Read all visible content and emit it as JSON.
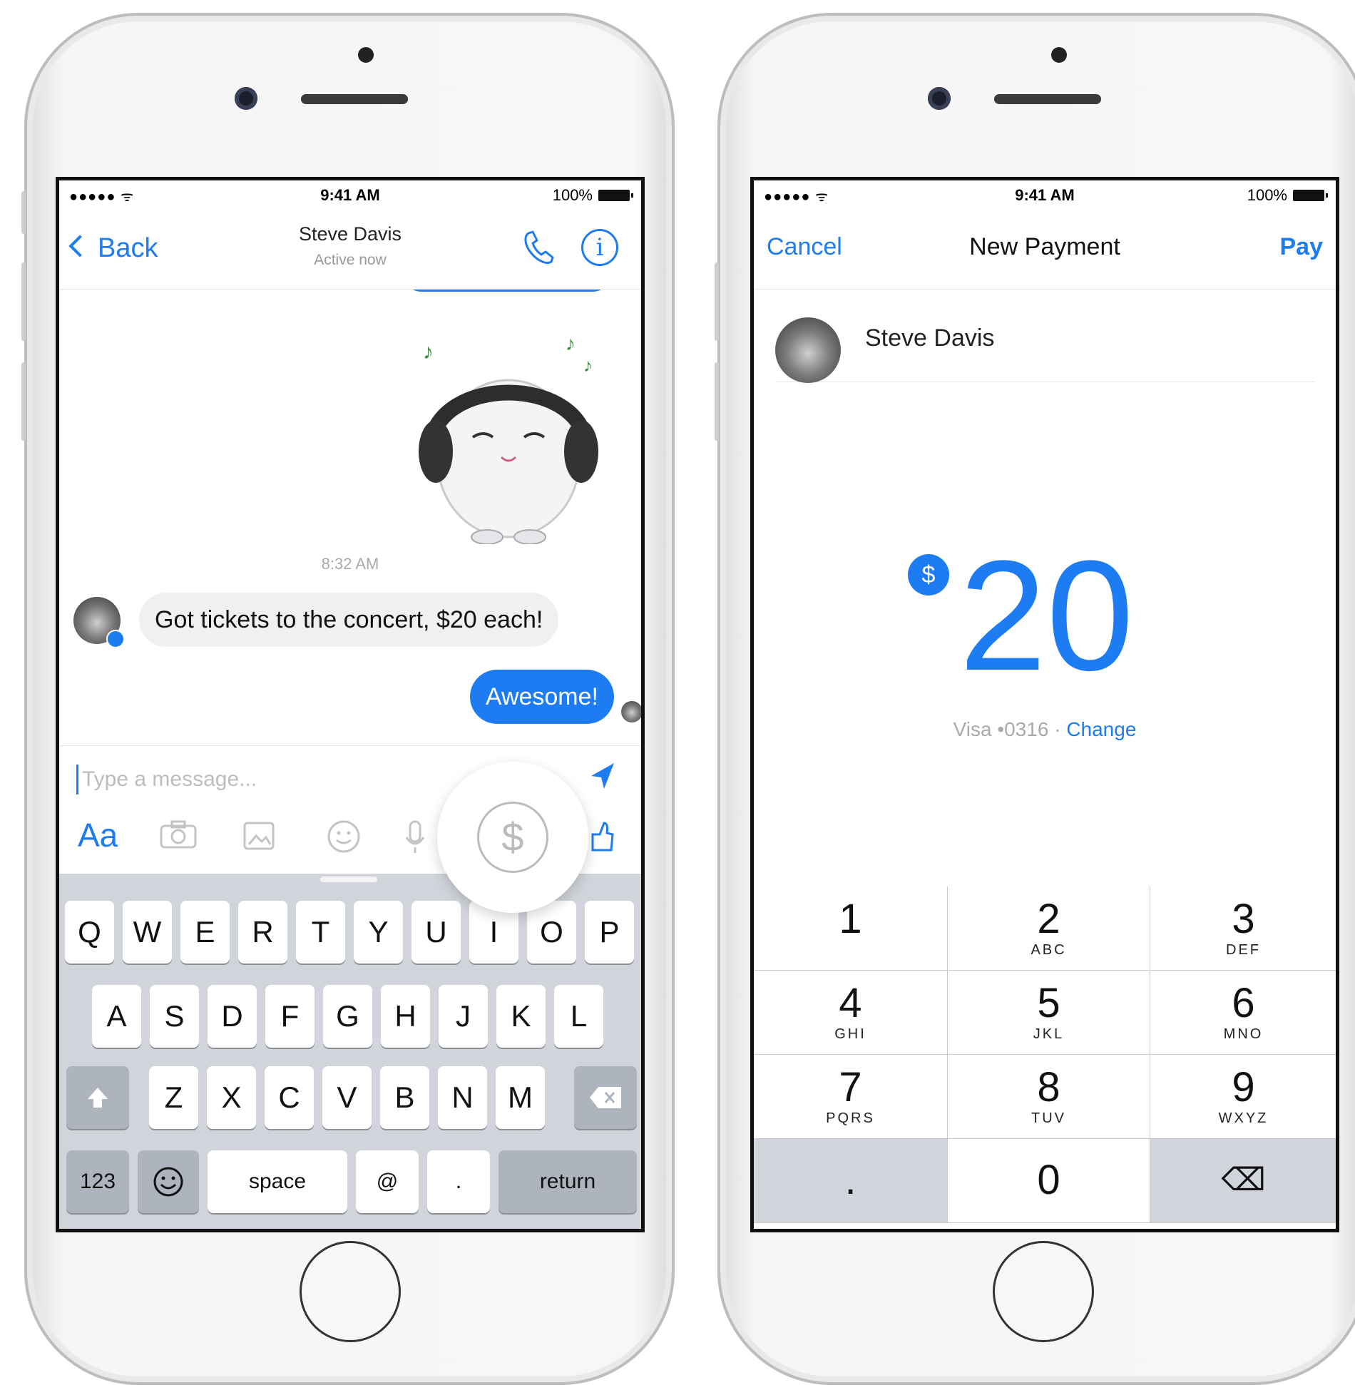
{
  "chat": {
    "status": {
      "signal": "●●●●● ᯤ",
      "time": "9:41 AM",
      "battery": "100%"
    },
    "back_label": "Back",
    "contact_name": "Steve Davis",
    "contact_status": "Active now",
    "timestamp": "8:32 AM",
    "incoming_message": "Got tickets to the concert, $20 each!",
    "outgoing_message": "Awesome!",
    "composer_placeholder": "Type a message...",
    "text_format_label": "Aa",
    "payment_icon_symbol": "$"
  },
  "keyboard": {
    "row1": [
      "Q",
      "W",
      "E",
      "R",
      "T",
      "Y",
      "U",
      "I",
      "O",
      "P"
    ],
    "row2": [
      "A",
      "S",
      "D",
      "F",
      "G",
      "H",
      "J",
      "K",
      "L"
    ],
    "row3": [
      "Z",
      "X",
      "C",
      "V",
      "B",
      "N",
      "M"
    ],
    "numbers_label": "123",
    "space_label": "space",
    "at_label": "@",
    "period_label": ".",
    "return_label": "return"
  },
  "payment": {
    "status": {
      "signal": "●●●●● ᯤ",
      "time": "9:41 AM",
      "battery": "100%"
    },
    "cancel_label": "Cancel",
    "title": "New Payment",
    "pay_label": "Pay",
    "recipient": "Steve Davis",
    "currency_symbol": "$",
    "amount": "20",
    "card_info": "Visa •0316 ·",
    "change_label": "Change",
    "keypad": [
      {
        "num": "1",
        "letters": ""
      },
      {
        "num": "2",
        "letters": "ABC"
      },
      {
        "num": "3",
        "letters": "DEF"
      },
      {
        "num": "4",
        "letters": "GHI"
      },
      {
        "num": "5",
        "letters": "JKL"
      },
      {
        "num": "6",
        "letters": "MNO"
      },
      {
        "num": "7",
        "letters": "PQRS"
      },
      {
        "num": "8",
        "letters": "TUV"
      },
      {
        "num": "9",
        "letters": "WXYZ"
      },
      {
        "num": ".",
        "letters": ""
      },
      {
        "num": "0",
        "letters": ""
      },
      {
        "num": "⌫",
        "letters": ""
      }
    ]
  },
  "colors": {
    "accent": "#1d7cf2",
    "keyboard_bg": "#d1d5db"
  }
}
